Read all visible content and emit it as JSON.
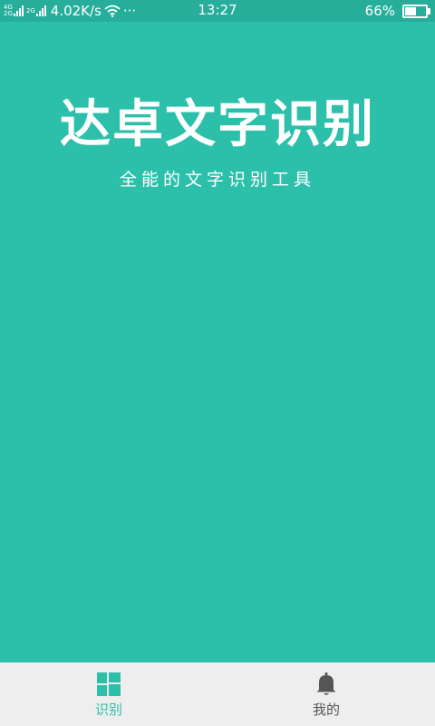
{
  "status_bar": {
    "net_tag_top": "4G",
    "net_tag_bottom": "2G",
    "net_tag_second": "2G",
    "speed": "4.02K/s",
    "more": "···",
    "time": "13:27",
    "battery_percent_text": "66%",
    "battery_level": 0.66
  },
  "main": {
    "title": "达卓文字识别",
    "subtitle": "全能的文字识别工具"
  },
  "bottom_nav": {
    "items": [
      {
        "label": "识别",
        "icon": "dashboard-icon",
        "active": true
      },
      {
        "label": "我的",
        "icon": "bell-icon",
        "active": false
      }
    ]
  },
  "colors": {
    "background": "#2cc0ab",
    "status_bar": "#27ae9b",
    "nav_background": "#eeeeee",
    "nav_active": "#2cc0ab",
    "nav_inactive": "#555555"
  }
}
